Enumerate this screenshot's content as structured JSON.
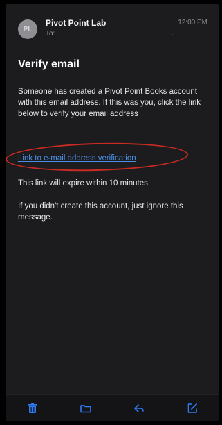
{
  "header": {
    "avatar_initials": "PL",
    "sender": "Pivot Point Lab",
    "to_label": "To:",
    "time": "12:00 PM"
  },
  "email": {
    "subject": "Verify email",
    "paragraph_1": "Someone has created a Pivot Point Books account with this email address. If this was you, click the link below to verify your email address",
    "link_text": "Link to e-mail address verification",
    "paragraph_2": "This link will expire within 10 minutes.",
    "paragraph_3": "If you didn't create this account, just ignore this message."
  },
  "toolbar": {
    "items": [
      "trash-icon",
      "folder-icon",
      "reply-icon",
      "compose-icon"
    ]
  },
  "colors": {
    "background": "#1c1c1e",
    "link": "#4a8fe7",
    "annotation_circle": "#c92a22",
    "toolbar_icons": "#2f7bf5"
  }
}
